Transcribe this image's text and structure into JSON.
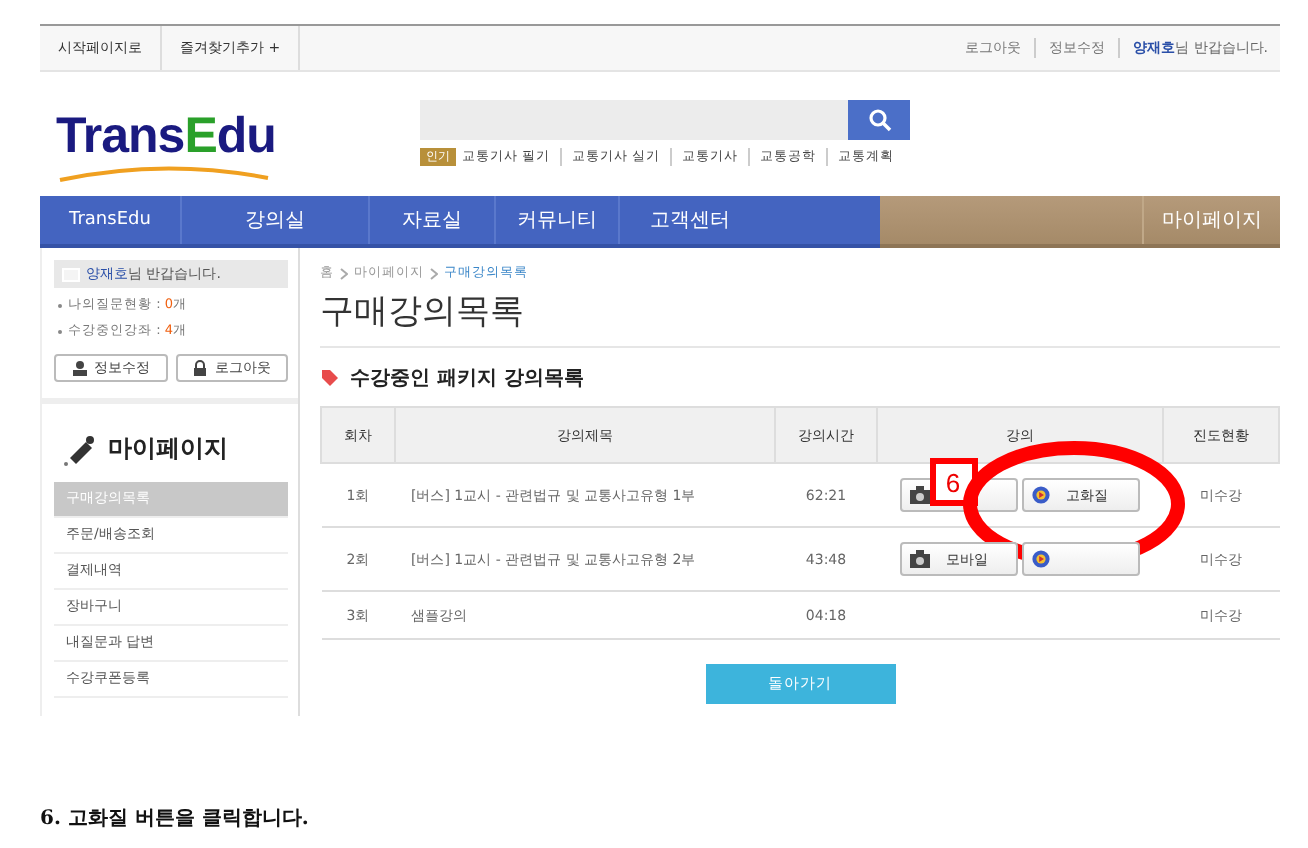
{
  "top_bar": {
    "links": [
      "시작페이지로",
      "즐겨찾기추가 +"
    ],
    "right_links": [
      "로그아웃",
      "정보수정"
    ],
    "user": "양재호",
    "greeting": "님 반갑습니다."
  },
  "logo": {
    "part1": "Trans",
    "part2": "E",
    "part3": "du"
  },
  "search": {
    "hot_label": "인기",
    "keywords": [
      "교통기사 필기",
      "교통기사 실기",
      "교통기사",
      "교통공학",
      "교통계획"
    ]
  },
  "nav": {
    "items": [
      "TransEdu",
      "강의실",
      "자료실",
      "커뮤니티",
      "고객센터"
    ],
    "right": "마이페이지"
  },
  "sidebar": {
    "user": "양재호",
    "greeting": "님 반갑습니다.",
    "stats": [
      {
        "label": "나의질문현황 : ",
        "count": "0",
        "unit": "개"
      },
      {
        "label": "수강중인강좌 : ",
        "count": "4",
        "unit": "개"
      }
    ],
    "buttons": [
      "정보수정",
      "로그아웃"
    ],
    "title": "마이페이지",
    "menu": [
      {
        "label": "구매강의목록",
        "selected": true
      },
      {
        "label": "주문/배송조회",
        "selected": false
      },
      {
        "label": "결제내역",
        "selected": false
      },
      {
        "label": "장바구니",
        "selected": false
      },
      {
        "label": "내질문과 답변",
        "selected": false
      },
      {
        "label": "수강쿠폰등록",
        "selected": false
      }
    ]
  },
  "breadcrumb": [
    "홈",
    "마이페이지",
    "구매강의목록"
  ],
  "page_title": "구매강의목록",
  "section_title": "수강중인 패키지 강의목록",
  "table": {
    "columns": [
      "회차",
      "강의제목",
      "강의시간",
      "강의",
      "진도현황"
    ],
    "rows": [
      {
        "no": "1회",
        "title": "[버스] 1교시 - 관련법규 및 교통사고유형 1부",
        "time": "62:21",
        "buttons": [
          {
            "kind": "mobile"
          },
          {
            "kind": "hd",
            "label": "고화질"
          }
        ],
        "status": "미수강"
      },
      {
        "no": "2회",
        "title": "[버스] 1교시 - 관련법규 및 교통사고유형 2부",
        "time": "43:48",
        "buttons": [
          {
            "kind": "mobile",
            "label": "모바일"
          },
          {
            "kind": "hd"
          }
        ],
        "status": "미수강"
      },
      {
        "no": "3회",
        "title": "샘플강의",
        "time": "04:18",
        "buttons": [],
        "status": "미수강"
      }
    ]
  },
  "back_button": "돌아가기",
  "annotation": {
    "step": "6"
  },
  "caption": "6. 고화질 버튼을 클릭합니다."
}
